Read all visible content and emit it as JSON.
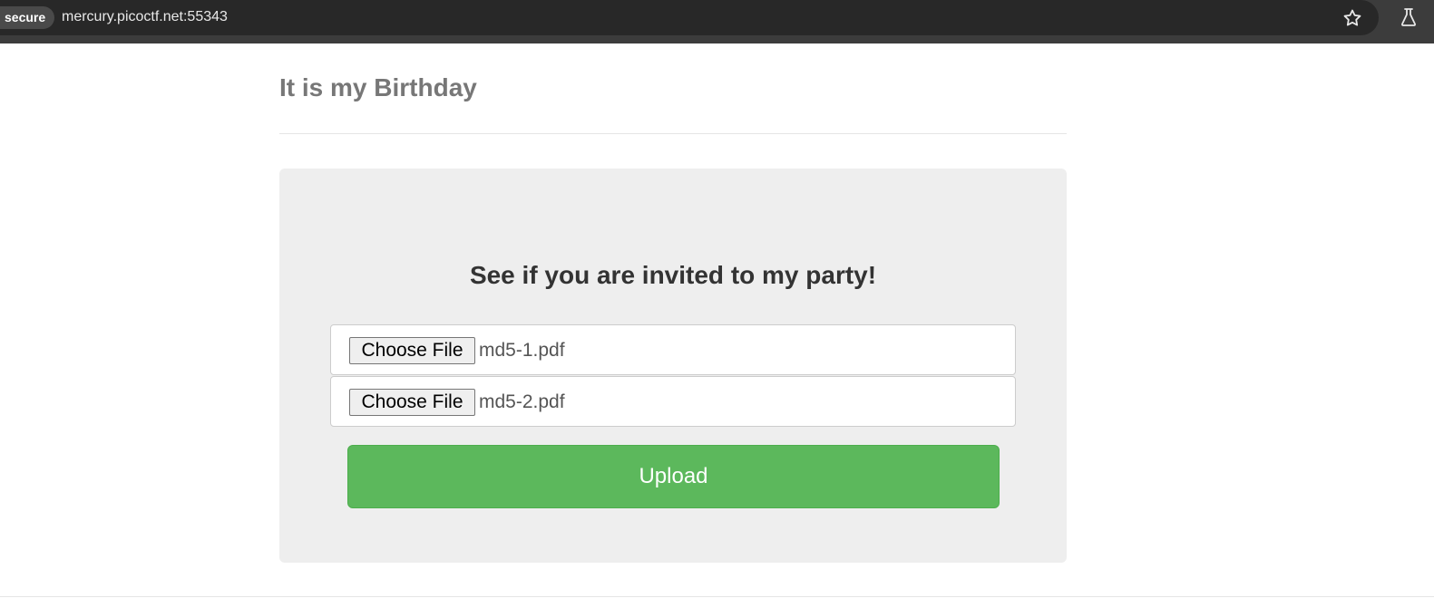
{
  "browser": {
    "security_chip": "secure",
    "url": "mercury.picoctf.net:55343",
    "icons": [
      "star-icon",
      "flask-icon"
    ]
  },
  "page": {
    "title": "It is my Birthday",
    "heading": "See if you are invited to my party!",
    "file_inputs": [
      {
        "button_label": "Choose File",
        "selected_file": "md5-1.pdf"
      },
      {
        "button_label": "Choose File",
        "selected_file": "md5-2.pdf"
      }
    ],
    "upload_label": "Upload"
  },
  "colors": {
    "upload_button": "#5cb85c",
    "jumbotron_background": "#eeeeee",
    "title_text": "#777777"
  }
}
